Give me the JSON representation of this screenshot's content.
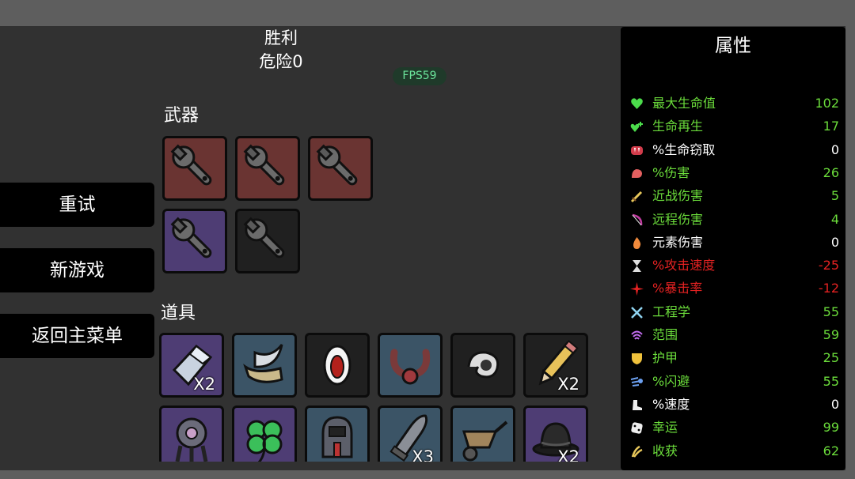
{
  "header": {
    "result": "胜利",
    "danger": "危险0",
    "fps": "FPS59"
  },
  "menu": {
    "retry": "重试",
    "new_game": "新游戏",
    "main_menu": "返回主菜单"
  },
  "weapons": {
    "label": "武器",
    "slots": [
      {
        "tier_color": "#6a3432",
        "icon": "wrench-icon"
      },
      {
        "tier_color": "#6a3432",
        "icon": "wrench-icon"
      },
      {
        "tier_color": "#6a3432",
        "icon": "wrench-icon"
      },
      {
        "tier_color": "#4e3d74",
        "icon": "wrench-icon"
      },
      {
        "tier_color": "#202020",
        "icon": "wrench-icon"
      }
    ]
  },
  "items": {
    "label": "道具",
    "slots": [
      {
        "icon": "crystal-icon",
        "qty": "X2"
      },
      {
        "icon": "claw-icon",
        "qty": ""
      },
      {
        "icon": "fanged-mouth-icon",
        "qty": ""
      },
      {
        "icon": "tentacle-creature-icon",
        "qty": ""
      },
      {
        "icon": "swirl-icon",
        "qty": ""
      },
      {
        "icon": "pencil-icon",
        "qty": "X2"
      },
      {
        "icon": "helmet-robot-icon",
        "qty": ""
      },
      {
        "icon": "four-leaf-clover-icon",
        "qty": ""
      },
      {
        "icon": "diving-helmet-icon",
        "qty": ""
      },
      {
        "icon": "bullet-icon",
        "qty": "X3"
      },
      {
        "icon": "wheelbarrow-icon",
        "qty": ""
      },
      {
        "icon": "bowler-hat-icon",
        "qty": "X2"
      }
    ]
  },
  "stats": {
    "title": "属性",
    "rows": [
      {
        "name": "最大生命值",
        "value": "102",
        "color": "#6bdc3b",
        "icon": "heart-icon"
      },
      {
        "name": "生命再生",
        "value": "17",
        "color": "#6bdc3b",
        "icon": "heart-plus-icon"
      },
      {
        "name": "%生命窃取",
        "value": "0",
        "color": "#ffffff",
        "icon": "fangs-icon"
      },
      {
        "name": "%伤害",
        "value": "26",
        "color": "#6bdc3b",
        "icon": "muscle-icon"
      },
      {
        "name": "近战伤害",
        "value": "5",
        "color": "#6bdc3b",
        "icon": "sword-icon"
      },
      {
        "name": "远程伤害",
        "value": "4",
        "color": "#6bdc3b",
        "icon": "bow-icon"
      },
      {
        "name": "元素伤害",
        "value": "0",
        "color": "#ffffff",
        "icon": "flame-icon"
      },
      {
        "name": "%攻击速度",
        "value": "-25",
        "color": "#e52222",
        "icon": "hourglass-icon"
      },
      {
        "name": "%暴击率",
        "value": "-12",
        "color": "#e52222",
        "icon": "crit-icon"
      },
      {
        "name": "工程学",
        "value": "55",
        "color": "#6bdc3b",
        "icon": "tools-icon"
      },
      {
        "name": "范围",
        "value": "59",
        "color": "#6bdc3b",
        "icon": "range-icon"
      },
      {
        "name": "护甲",
        "value": "25",
        "color": "#6bdc3b",
        "icon": "shield-icon"
      },
      {
        "name": "%闪避",
        "value": "55",
        "color": "#6bdc3b",
        "icon": "dodge-icon"
      },
      {
        "name": "%速度",
        "value": "0",
        "color": "#ffffff",
        "icon": "boot-icon"
      },
      {
        "name": "幸运",
        "value": "99",
        "color": "#6bdc3b",
        "icon": "dice-icon"
      },
      {
        "name": "收获",
        "value": "62",
        "color": "#6bdc3b",
        "icon": "harvest-icon"
      }
    ]
  }
}
